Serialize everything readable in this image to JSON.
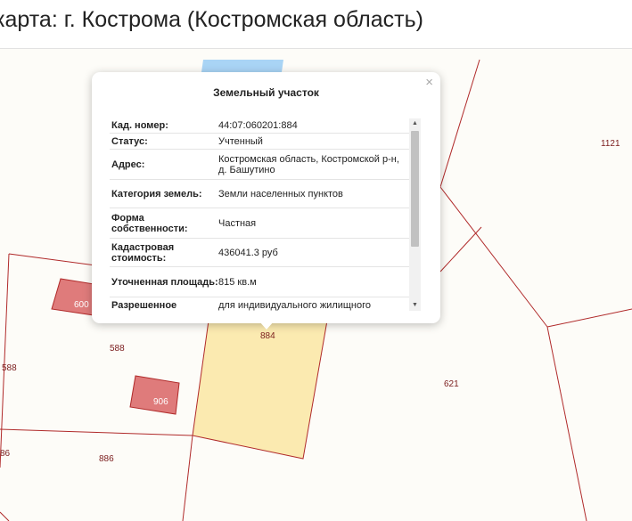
{
  "header": {
    "title": "карта: г. Кострома (Костромская область)"
  },
  "map": {
    "labels": {
      "l1121": "1121",
      "l600": "600",
      "l588a": "588",
      "l588b": "588",
      "l906": "906",
      "l884": "884",
      "l621": "621",
      "l886": "886",
      "l86": "86"
    },
    "colors": {
      "boundary": "#b02a2a",
      "selected_fill": "#fbeab0",
      "building_fill": "#df7b7b",
      "water": "#a9d4f5"
    }
  },
  "popup": {
    "title": "Земельный участок",
    "close_label": "×",
    "rows": [
      {
        "label": "Кад. номер:",
        "value": "44:07:060201:884"
      },
      {
        "label": "Статус:",
        "value": "Учтенный"
      },
      {
        "label": "Адрес:",
        "value": "Костромская область, Костромской р-н, д. Башутино"
      },
      {
        "label": "Категория земель:",
        "value": "Земли населенных пунктов"
      },
      {
        "label": "Форма собственности:",
        "value": "Частная"
      },
      {
        "label": "Кадастровая стоимость:",
        "value": "436041.3 руб"
      },
      {
        "label": "Уточненная площадь:",
        "value": "815 кв.м"
      },
      {
        "label": "Разрешенное",
        "value": "для индивидуального жилищного"
      }
    ],
    "scrollbar": {
      "up": "▲",
      "down": "▼"
    }
  }
}
